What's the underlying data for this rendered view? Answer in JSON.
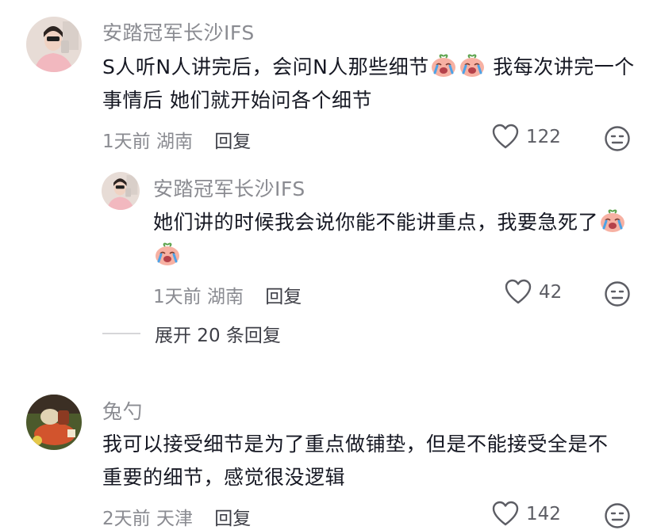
{
  "comments": [
    {
      "username": "安踏冠军长沙IFS",
      "content_a": "S人听N人讲完后，会问N人那些细节",
      "content_b": " 我每次讲完一个事情后  她们就开始问各个细节",
      "emoji": "crying-face-emoji",
      "time": "1天前",
      "location": "湖南",
      "reply_label": "回复",
      "likes": "122",
      "replies": [
        {
          "username": "安踏冠军长沙IFS",
          "content_a": "她们讲的时候我会说你能不能讲重点，我要急死了",
          "emoji": "crying-face-emoji",
          "time": "1天前",
          "location": "湖南",
          "reply_label": "回复",
          "likes": "42"
        }
      ],
      "expand_label": "展开 20 条回复"
    },
    {
      "username": "兔勺",
      "content_a": "我可以接受细节是为了重点做铺垫，但是不能接受全是不重要的细节，感觉很没逻辑",
      "time": "2天前",
      "location": "天津",
      "reply_label": "回复",
      "likes": "142"
    }
  ],
  "icons": {
    "like": "heart-outline-icon",
    "dislike": "neutral-face-icon"
  },
  "colors": {
    "primary_text": "#161823",
    "secondary_text": "#8a8b91",
    "divider": "#d6d6d9"
  }
}
